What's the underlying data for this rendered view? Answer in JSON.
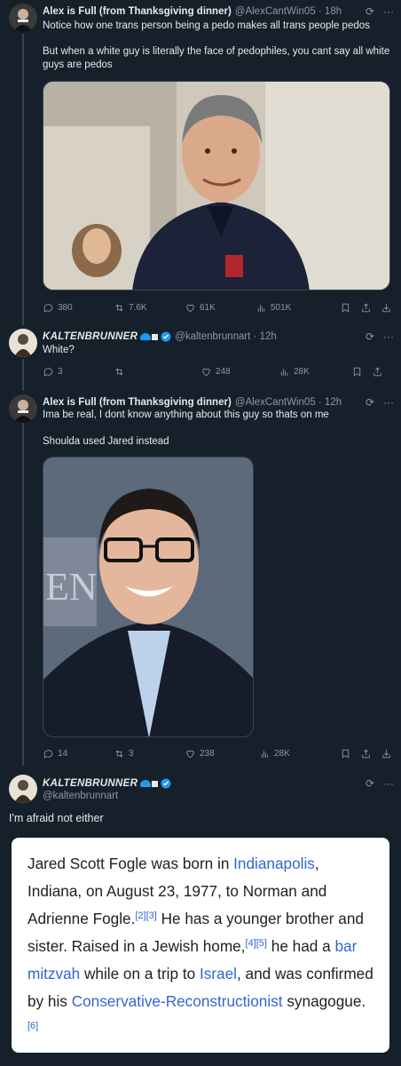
{
  "tweets": [
    {
      "name": "Alex is Full (from Thanksgiving dinner)",
      "handle": "@AlexCantWin05 · 18h",
      "text_lines": [
        "Notice how one trans person being a pedo makes all trans people pedos",
        "",
        "But when a white guy is literally the face of pedophiles, you cant say all white guys are pedos"
      ],
      "actions": {
        "replies": "380",
        "retweets": "7.6K",
        "likes": "61K",
        "views": "501K"
      }
    },
    {
      "name": "KALTENBRUNNER",
      "handle": "@kaltenbrunnart · 12h",
      "text": "White?",
      "actions": {
        "replies": "3",
        "retweets": "",
        "likes": "248",
        "views": "28K"
      }
    },
    {
      "name": "Alex is Full (from Thanksgiving dinner)",
      "handle": "@AlexCantWin05 · 12h",
      "text_line1": "Ima be real, I dont know anything about this guy so thats on me",
      "text_line2": "Shoulda used Jared instead",
      "actions": {
        "replies": "14",
        "retweets": "3",
        "likes": "238",
        "views": "28K"
      }
    },
    {
      "name": "KALTENBRUNNER",
      "handle": "@kaltenbrunnart",
      "text": "I'm afraid not either"
    }
  ],
  "wiki": {
    "t1": "Jared Scott Fogle was born in ",
    "l1": "Indianapolis",
    "t2": ", Indiana, on August 23, 1977, to Norman and Adrienne Fogle.",
    "s1": "[2][3]",
    "t3": " He has a younger brother and sister. Raised in a Jewish home,",
    "s2": "[4][5]",
    "t4": " he had a ",
    "l2": "bar mitzvah",
    "t5": " while on a trip to ",
    "l3": "Israel",
    "t6": ", and was confirmed by his ",
    "l4": "Conservative-Reconstructionist",
    "t7": " synagogue.",
    "s3": "[6]"
  },
  "icons": [
    "grok-icon",
    "more-icon",
    "reply-icon",
    "retweet-icon",
    "like-icon",
    "views-icon",
    "bookmark-icon",
    "share-icon",
    "download-icon",
    "verified-icon"
  ],
  "colors": {
    "background": "#15202b",
    "secondary_text": "#8b98a5",
    "link": "#3366cc",
    "verified": "#1d9bf0"
  }
}
